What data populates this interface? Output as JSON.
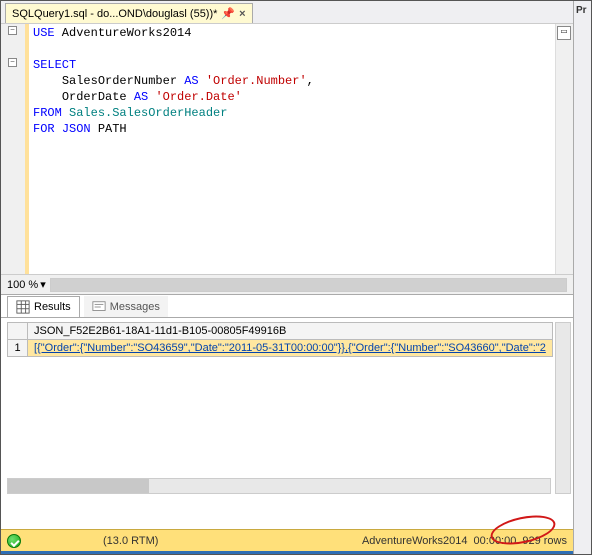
{
  "tab": {
    "title": "SQLQuery1.sql - do...OND\\douglasl (55))*"
  },
  "editor": {
    "line1_use": "USE",
    "line1_db": " AdventureWorks2014",
    "select_kw": "SELECT",
    "col1_name": "SalesOrderNumber",
    "as_kw": "AS",
    "col1_alias": "'Order.Number'",
    "col2_name": "OrderDate",
    "col2_alias": "'Order.Date'",
    "from_kw": "FROM",
    "from_obj": " Sales.SalesOrderHeader",
    "for_kw": "FOR",
    "json_kw": "JSON",
    "path_kw": "PATH",
    "zoom": "100 %"
  },
  "results": {
    "tab_results": "Results",
    "tab_messages": "Messages",
    "column_header": "JSON_F52E2B61-18A1-11d1-B105-00805F49916B",
    "row_number": "1",
    "cell_value": "[{\"Order\":{\"Number\":\"SO43659\",\"Date\":\"2011-05-31T00:00:00\"}},{\"Order\":{\"Number\":\"SO43660\",\"Date\":\"2"
  },
  "status": {
    "version": "(13.0 RTM)",
    "database": "AdventureWorks2014",
    "time": "00:00:00",
    "rows": "929 rows"
  },
  "right_panel_label": "Pr"
}
